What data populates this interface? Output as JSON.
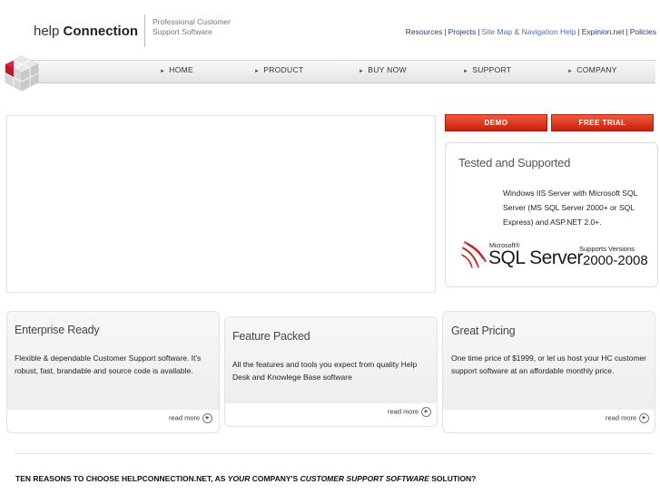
{
  "header": {
    "logo_light": "help ",
    "logo_bold": "Connection",
    "tagline": "Professional Customer Support Software",
    "links": [
      {
        "label": "Resources",
        "color": "#1a3a8c"
      },
      {
        "label": "Projects",
        "color": "#1a3a8c"
      },
      {
        "label": "Site Map & Navigation Help",
        "color": "#4a6fc4"
      },
      {
        "label": "Expinion.net",
        "color": "#1a3a8c"
      },
      {
        "label": "Policies",
        "color": "#1a3a8c"
      }
    ]
  },
  "nav": {
    "items": [
      "HOME",
      "PRODUCT",
      "BUY NOW",
      "SUPPORT",
      "COMPANY"
    ]
  },
  "buttons": {
    "demo": "DEMO",
    "free_trial": "FREE TRIAL"
  },
  "tested": {
    "title": "Tested and Supported",
    "body": "Windows IIS Server with Microsoft SQL Server (MS SQL Server 2000+ or SQL Express) and ASP.NET 2.0+.",
    "sql_microsoft": "Microsoft®",
    "sql_name": "SQL Server",
    "sql_supports": "Supports Versions",
    "sql_years": "2000-2008"
  },
  "features": [
    {
      "title": "Enterprise Ready",
      "body": "Flexible & dependable Customer Support software. It's robust, fast, brandable and source code is available.",
      "link": "read more"
    },
    {
      "title": "Feature Packed",
      "body": "All the features and tools you expect from quality Help Desk and Knowlege Base software",
      "link": "read more"
    },
    {
      "title": "Great Pricing",
      "body": "One time price of $1999, or let us host your HC customer support software at an affordable monthly price.",
      "link": "read more"
    }
  ],
  "reasons": {
    "part1": "TEN REASONS TO CHOOSE HELPCONNECTION.NET, AS ",
    "part2": "YOUR",
    "part3": " COMPANY'S ",
    "part4": "CUSTOMER SUPPORT SOFTWARE",
    "part5": " SOLUTION?"
  },
  "colors": {
    "accent_red": "#d9301a",
    "link_blue": "#1a3a8c"
  }
}
